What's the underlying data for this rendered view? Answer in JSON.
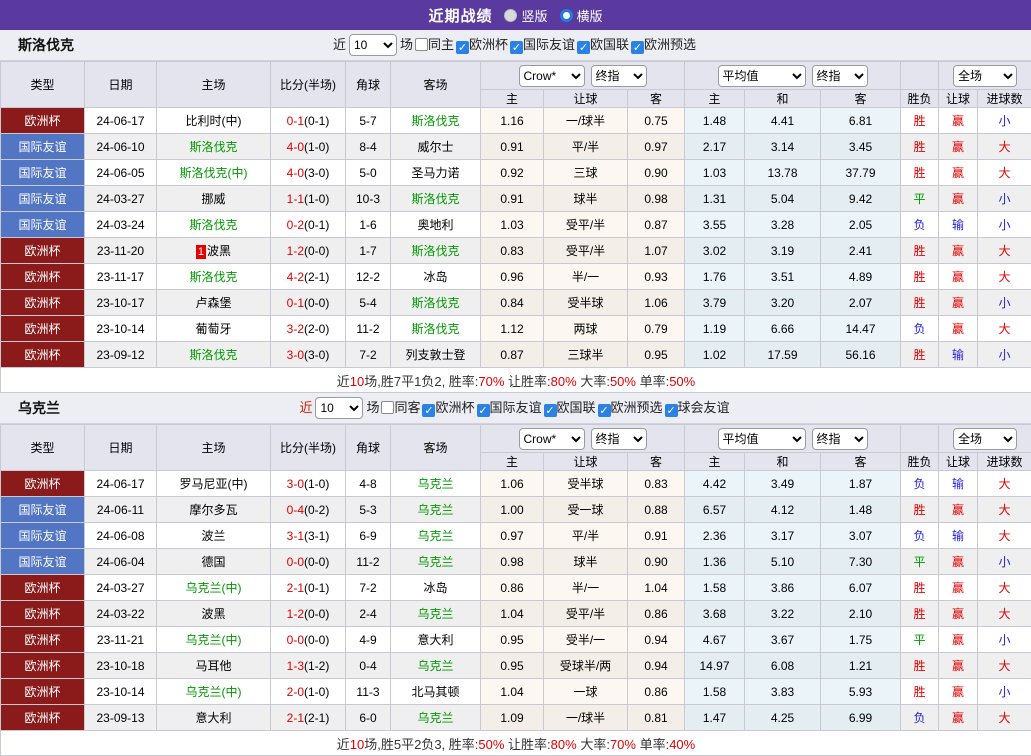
{
  "topbar": {
    "title": "近期战绩",
    "radios": [
      {
        "label": "竖版",
        "selected": true
      },
      {
        "label": "横版",
        "selected": false
      }
    ]
  },
  "table_header": {
    "left_cols": [
      "类型",
      "日期",
      "主场",
      "比分(半场)",
      "角球",
      "客场"
    ],
    "dropdowns": [
      "Crow*",
      "终指",
      "平均值",
      "终指",
      "全场"
    ],
    "sub_cols": [
      "主",
      "让球",
      "客",
      "主",
      "和",
      "客",
      "胜负",
      "让球",
      "进球数"
    ]
  },
  "colors": {
    "topbar_bg": "#5a3a9f",
    "type": {
      "欧洲杯": "#8b1a1a",
      "国际友谊": "#5276c3"
    },
    "result": {
      "胜": "#e60000",
      "平": "#009900",
      "负": "#2222dd",
      "赢": "#e60000",
      "输": "#2222dd",
      "大": "#e60000",
      "小": "#2222dd"
    },
    "team_green": "#009900",
    "score_red": "#e60000"
  },
  "sections": [
    {
      "team": "斯洛伐克",
      "filter": {
        "near": "近",
        "near_red": false,
        "count": "10",
        "games": "场",
        "same": {
          "label": "同主",
          "checked": false
        },
        "comps": [
          {
            "label": "欧洲杯",
            "checked": true
          },
          {
            "label": "国际友谊",
            "checked": true
          },
          {
            "label": "欧国联",
            "checked": true
          },
          {
            "label": "欧洲预选",
            "checked": true
          }
        ]
      },
      "rows": [
        {
          "type": "欧洲杯",
          "date": "24-06-17",
          "home": "比利时(中)",
          "homeGreen": false,
          "score": "0-1",
          "half": "(0-1)",
          "corner": "5-7",
          "away": "斯洛伐克",
          "awayGreen": true,
          "o1": "1.16",
          "line": "一/球半",
          "o2": "0.75",
          "m1": "1.48",
          "m2": "4.41",
          "m3": "6.81",
          "r1": "胜",
          "r2": "赢",
          "r3": "小"
        },
        {
          "type": "国际友谊",
          "date": "24-06-10",
          "home": "斯洛伐克",
          "homeGreen": true,
          "score": "4-0",
          "half": "(1-0)",
          "corner": "8-4",
          "away": "威尔士",
          "awayGreen": false,
          "o1": "0.91",
          "line": "平/半",
          "o2": "0.97",
          "m1": "2.17",
          "m2": "3.14",
          "m3": "3.45",
          "r1": "胜",
          "r2": "赢",
          "r3": "大"
        },
        {
          "type": "国际友谊",
          "date": "24-06-05",
          "home": "斯洛伐克(中)",
          "homeGreen": true,
          "score": "4-0",
          "half": "(3-0)",
          "corner": "5-0",
          "away": "圣马力诺",
          "awayGreen": false,
          "o1": "0.92",
          "line": "三球",
          "o2": "0.90",
          "m1": "1.03",
          "m2": "13.78",
          "m3": "37.79",
          "r1": "胜",
          "r2": "赢",
          "r3": "大"
        },
        {
          "type": "国际友谊",
          "date": "24-03-27",
          "home": "挪威",
          "homeGreen": false,
          "score": "1-1",
          "half": "(1-0)",
          "corner": "10-3",
          "away": "斯洛伐克",
          "awayGreen": true,
          "o1": "0.91",
          "line": "球半",
          "o2": "0.98",
          "m1": "1.31",
          "m2": "5.04",
          "m3": "9.42",
          "r1": "平",
          "r2": "赢",
          "r3": "小"
        },
        {
          "type": "国际友谊",
          "date": "24-03-24",
          "home": "斯洛伐克",
          "homeGreen": true,
          "score": "0-2",
          "half": "(0-1)",
          "corner": "1-6",
          "away": "奥地利",
          "awayGreen": false,
          "o1": "1.03",
          "line": "受平/半",
          "o2": "0.87",
          "m1": "3.55",
          "m2": "3.28",
          "m3": "2.05",
          "r1": "负",
          "r2": "输",
          "r3": "小"
        },
        {
          "type": "欧洲杯",
          "date": "23-11-20",
          "home": "波黑",
          "homeGreen": false,
          "homeBadge": "1",
          "score": "1-2",
          "half": "(0-0)",
          "corner": "1-7",
          "away": "斯洛伐克",
          "awayGreen": true,
          "o1": "0.83",
          "line": "受平/半",
          "o2": "1.07",
          "m1": "3.02",
          "m2": "3.19",
          "m3": "2.41",
          "r1": "胜",
          "r2": "赢",
          "r3": "大"
        },
        {
          "type": "欧洲杯",
          "date": "23-11-17",
          "home": "斯洛伐克",
          "homeGreen": true,
          "score": "4-2",
          "half": "(2-1)",
          "corner": "12-2",
          "away": "冰岛",
          "awayGreen": false,
          "o1": "0.96",
          "line": "半/一",
          "o2": "0.93",
          "m1": "1.76",
          "m2": "3.51",
          "m3": "4.89",
          "r1": "胜",
          "r2": "赢",
          "r3": "大"
        },
        {
          "type": "欧洲杯",
          "date": "23-10-17",
          "home": "卢森堡",
          "homeGreen": false,
          "score": "0-1",
          "half": "(0-0)",
          "corner": "5-4",
          "away": "斯洛伐克",
          "awayGreen": true,
          "o1": "0.84",
          "line": "受半球",
          "o2": "1.06",
          "m1": "3.79",
          "m2": "3.20",
          "m3": "2.07",
          "r1": "胜",
          "r2": "赢",
          "r3": "小"
        },
        {
          "type": "欧洲杯",
          "date": "23-10-14",
          "home": "葡萄牙",
          "homeGreen": false,
          "score": "3-2",
          "half": "(2-0)",
          "corner": "11-2",
          "away": "斯洛伐克",
          "awayGreen": true,
          "o1": "1.12",
          "line": "两球",
          "o2": "0.79",
          "m1": "1.19",
          "m2": "6.66",
          "m3": "14.47",
          "r1": "负",
          "r2": "赢",
          "r3": "大"
        },
        {
          "type": "欧洲杯",
          "date": "23-09-12",
          "home": "斯洛伐克",
          "homeGreen": true,
          "score": "3-0",
          "half": "(3-0)",
          "corner": "7-2",
          "away": "列支敦士登",
          "awayGreen": false,
          "o1": "0.87",
          "line": "三球半",
          "o2": "0.95",
          "m1": "1.02",
          "m2": "17.59",
          "m3": "56.16",
          "r1": "胜",
          "r2": "输",
          "r3": "小"
        }
      ],
      "summary": [
        {
          "t": "近",
          "red": false
        },
        {
          "t": "10",
          "red": true
        },
        {
          "t": "场,胜7平1负2, 胜率:",
          "red": false
        },
        {
          "t": "70%",
          "red": true
        },
        {
          "t": " 让胜率:",
          "red": false
        },
        {
          "t": "80%",
          "red": true
        },
        {
          "t": " 大率:",
          "red": false
        },
        {
          "t": "50%",
          "red": true
        },
        {
          "t": " 单率:",
          "red": false
        },
        {
          "t": "50%",
          "red": true
        }
      ]
    },
    {
      "team": "乌克兰",
      "filter": {
        "near": "近",
        "near_red": true,
        "count": "10",
        "games": "场",
        "same": {
          "label": "同客",
          "checked": false
        },
        "comps": [
          {
            "label": "欧洲杯",
            "checked": true
          },
          {
            "label": "国际友谊",
            "checked": true
          },
          {
            "label": "欧国联",
            "checked": true
          },
          {
            "label": "欧洲预选",
            "checked": true
          },
          {
            "label": "球会友谊",
            "checked": true
          }
        ]
      },
      "rows": [
        {
          "type": "欧洲杯",
          "date": "24-06-17",
          "home": "罗马尼亚(中)",
          "homeGreen": false,
          "score": "3-0",
          "half": "(1-0)",
          "corner": "4-8",
          "away": "乌克兰",
          "awayGreen": true,
          "o1": "1.06",
          "line": "受半球",
          "o2": "0.83",
          "m1": "4.42",
          "m2": "3.49",
          "m3": "1.87",
          "r1": "负",
          "r2": "输",
          "r3": "大"
        },
        {
          "type": "国际友谊",
          "date": "24-06-11",
          "home": "摩尔多瓦",
          "homeGreen": false,
          "score": "0-4",
          "half": "(0-2)",
          "corner": "5-3",
          "away": "乌克兰",
          "awayGreen": true,
          "o1": "1.00",
          "line": "受一球",
          "o2": "0.88",
          "m1": "6.57",
          "m2": "4.12",
          "m3": "1.48",
          "r1": "胜",
          "r2": "赢",
          "r3": "大"
        },
        {
          "type": "国际友谊",
          "date": "24-06-08",
          "home": "波兰",
          "homeGreen": false,
          "score": "3-1",
          "half": "(3-1)",
          "corner": "6-9",
          "away": "乌克兰",
          "awayGreen": true,
          "o1": "0.97",
          "line": "平/半",
          "o2": "0.91",
          "m1": "2.36",
          "m2": "3.17",
          "m3": "3.07",
          "r1": "负",
          "r2": "输",
          "r3": "大"
        },
        {
          "type": "国际友谊",
          "date": "24-06-04",
          "home": "德国",
          "homeGreen": false,
          "score": "0-0",
          "half": "(0-0)",
          "corner": "11-2",
          "away": "乌克兰",
          "awayGreen": true,
          "o1": "0.98",
          "line": "球半",
          "o2": "0.90",
          "m1": "1.36",
          "m2": "5.10",
          "m3": "7.30",
          "r1": "平",
          "r2": "赢",
          "r3": "小"
        },
        {
          "type": "欧洲杯",
          "date": "24-03-27",
          "home": "乌克兰(中)",
          "homeGreen": true,
          "score": "2-1",
          "half": "(0-1)",
          "corner": "7-2",
          "away": "冰岛",
          "awayGreen": false,
          "o1": "0.86",
          "line": "半/一",
          "o2": "1.04",
          "m1": "1.58",
          "m2": "3.86",
          "m3": "6.07",
          "r1": "胜",
          "r2": "赢",
          "r3": "大"
        },
        {
          "type": "欧洲杯",
          "date": "24-03-22",
          "home": "波黑",
          "homeGreen": false,
          "score": "1-2",
          "half": "(0-0)",
          "corner": "2-4",
          "away": "乌克兰",
          "awayGreen": true,
          "o1": "1.04",
          "line": "受平/半",
          "o2": "0.86",
          "m1": "3.68",
          "m2": "3.22",
          "m3": "2.10",
          "r1": "胜",
          "r2": "赢",
          "r3": "大"
        },
        {
          "type": "欧洲杯",
          "date": "23-11-21",
          "home": "乌克兰(中)",
          "homeGreen": true,
          "score": "0-0",
          "half": "(0-0)",
          "corner": "4-9",
          "away": "意大利",
          "awayGreen": false,
          "o1": "0.95",
          "line": "受半/一",
          "o2": "0.94",
          "m1": "4.67",
          "m2": "3.67",
          "m3": "1.75",
          "r1": "平",
          "r2": "赢",
          "r3": "小"
        },
        {
          "type": "欧洲杯",
          "date": "23-10-18",
          "home": "马耳他",
          "homeGreen": false,
          "score": "1-3",
          "half": "(1-2)",
          "corner": "0-4",
          "away": "乌克兰",
          "awayGreen": true,
          "o1": "0.95",
          "line": "受球半/两",
          "o2": "0.94",
          "m1": "14.97",
          "m2": "6.08",
          "m3": "1.21",
          "r1": "胜",
          "r2": "赢",
          "r3": "大"
        },
        {
          "type": "欧洲杯",
          "date": "23-10-14",
          "home": "乌克兰(中)",
          "homeGreen": true,
          "score": "2-0",
          "half": "(1-0)",
          "corner": "11-3",
          "away": "北马其顿",
          "awayGreen": false,
          "o1": "1.04",
          "line": "一球",
          "o2": "0.86",
          "m1": "1.58",
          "m2": "3.83",
          "m3": "5.93",
          "r1": "胜",
          "r2": "赢",
          "r3": "小"
        },
        {
          "type": "欧洲杯",
          "date": "23-09-13",
          "home": "意大利",
          "homeGreen": false,
          "score": "2-1",
          "half": "(2-1)",
          "corner": "6-0",
          "away": "乌克兰",
          "awayGreen": true,
          "o1": "1.09",
          "line": "一/球半",
          "o2": "0.81",
          "m1": "1.47",
          "m2": "4.25",
          "m3": "6.99",
          "r1": "负",
          "r2": "赢",
          "r3": "大"
        }
      ],
      "summary": [
        {
          "t": "近",
          "red": false
        },
        {
          "t": "10",
          "red": true
        },
        {
          "t": "场,胜5平2负3, 胜率:",
          "red": false
        },
        {
          "t": "50%",
          "red": true
        },
        {
          "t": " 让胜率:",
          "red": false
        },
        {
          "t": "80%",
          "red": true
        },
        {
          "t": " 大率:",
          "red": false
        },
        {
          "t": "70%",
          "red": true
        },
        {
          "t": " 单率:",
          "red": false
        },
        {
          "t": "40%",
          "red": true
        }
      ]
    }
  ]
}
